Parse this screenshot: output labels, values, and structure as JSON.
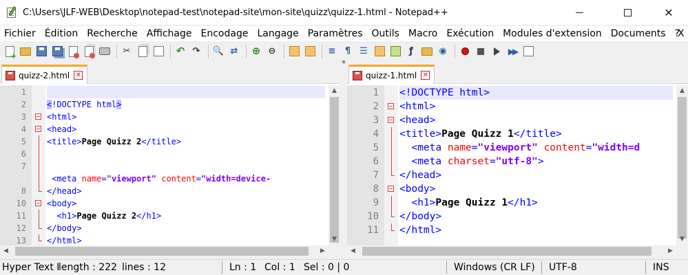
{
  "window": {
    "title": "C:\\Users\\JLF-WEB\\Desktop\\notepad-test\\notepad-site\\mon-site\\quizz\\quizz-1.html - Notepad++",
    "minimize_label": "",
    "maximize_label": "",
    "close_label": "✕"
  },
  "menu": {
    "items": [
      "Fichier",
      "Édition",
      "Recherche",
      "Affichage",
      "Encodage",
      "Langage",
      "Paramètres",
      "Outils",
      "Macro",
      "Exécution",
      "Modules d'extension",
      "Documents",
      "?"
    ],
    "close": "X"
  },
  "toolbar": {
    "icons": [
      "new-file-icon",
      "open-folder-icon",
      "save-icon",
      "save-all-icon",
      "close-icon",
      "close-all-icon",
      "print-icon",
      "cut-icon",
      "copy-icon",
      "paste-icon",
      "undo-icon",
      "redo-icon",
      "find-icon",
      "replace-icon",
      "zoom-in-icon",
      "zoom-out-icon",
      "sync-vertical-icon",
      "sync-horizontal-icon",
      "word-wrap-icon",
      "show-all-chars-icon",
      "indent-guide-icon",
      "lang-define-icon",
      "doc-map-icon",
      "function-list-icon",
      "folder-workspace-icon",
      "monitoring-icon",
      "record-macro-icon",
      "stop-macro-icon",
      "play-macro-icon",
      "run-macro-multiple-icon",
      "save-macro-icon"
    ]
  },
  "left_pane": {
    "tab_label": "quizz-2.html",
    "lines": [
      {
        "n": "1",
        "fold": "",
        "tokens": []
      },
      {
        "n": "2",
        "fold": "",
        "tokens": [
          {
            "c": "t-tag t-hl",
            "t": "<"
          },
          {
            "c": "t-tag",
            "t": "!DOCTYPE html"
          },
          {
            "c": "t-tag t-hl",
            "t": ">"
          }
        ]
      },
      {
        "n": "3",
        "fold": "open",
        "tokens": [
          {
            "c": "t-tag",
            "t": "<html>"
          }
        ]
      },
      {
        "n": "4",
        "fold": "open",
        "tokens": [
          {
            "c": "t-tag",
            "t": "<head>"
          }
        ]
      },
      {
        "n": "5",
        "fold": "line",
        "tokens": [
          {
            "c": "t-tag",
            "t": "<title>"
          },
          {
            "c": "t-txt",
            "t": "Page Quizz 2"
          },
          {
            "c": "t-tag",
            "t": "</title>"
          }
        ]
      },
      {
        "n": "6",
        "fold": "line",
        "tokens": []
      },
      {
        "n": "7",
        "fold": "line",
        "tokens": []
      },
      {
        "n": "",
        "fold": "line",
        "tokens": [
          {
            "c": "t-plain",
            "t": " "
          },
          {
            "c": "t-tag",
            "t": "<meta "
          },
          {
            "c": "t-attr",
            "t": "name"
          },
          {
            "c": "t-tag",
            "t": "="
          },
          {
            "c": "t-val",
            "t": "\"viewport\""
          },
          {
            "c": "t-plain",
            "t": " "
          },
          {
            "c": "t-attr",
            "t": "content"
          },
          {
            "c": "t-tag",
            "t": "="
          },
          {
            "c": "t-val",
            "t": "\"width=device-"
          }
        ]
      },
      {
        "n": "8",
        "fold": "end",
        "tokens": [
          {
            "c": "t-tag",
            "t": "</head>"
          }
        ]
      },
      {
        "n": "10",
        "fold": "open",
        "tokens": [
          {
            "c": "t-tag",
            "t": "<body>"
          }
        ]
      },
      {
        "n": "11",
        "fold": "line",
        "tokens": [
          {
            "c": "t-plain",
            "t": "  "
          },
          {
            "c": "t-tag",
            "t": "<h1>"
          },
          {
            "c": "t-txt",
            "t": "Page Quizz 2"
          },
          {
            "c": "t-tag",
            "t": "</h1>"
          }
        ]
      },
      {
        "n": "12",
        "fold": "end",
        "tokens": [
          {
            "c": "t-tag",
            "t": "</body>"
          }
        ]
      },
      {
        "n": "13",
        "fold": "end",
        "tokens": [
          {
            "c": "t-tag",
            "t": "</html>"
          }
        ]
      }
    ]
  },
  "right_pane": {
    "tab_label": "quizz-1.html",
    "lines": [
      {
        "n": "1",
        "fold": "",
        "tokens": [
          {
            "c": "t-tag",
            "t": "<!DOCTYPE html>"
          }
        ]
      },
      {
        "n": "2",
        "fold": "open",
        "tokens": [
          {
            "c": "t-tag",
            "t": "<html>"
          }
        ]
      },
      {
        "n": "3",
        "fold": "open",
        "tokens": [
          {
            "c": "t-tag",
            "t": "<head>"
          }
        ]
      },
      {
        "n": "4",
        "fold": "line",
        "tokens": [
          {
            "c": "t-tag",
            "t": "<title>"
          },
          {
            "c": "t-txt",
            "t": "Page Quizz 1"
          },
          {
            "c": "t-tag",
            "t": "</title>"
          }
        ]
      },
      {
        "n": "5",
        "fold": "line",
        "tokens": [
          {
            "c": "t-plain",
            "t": "  "
          },
          {
            "c": "t-tag",
            "t": "<meta "
          },
          {
            "c": "t-attr",
            "t": "name"
          },
          {
            "c": "t-tag",
            "t": "="
          },
          {
            "c": "t-val",
            "t": "\"viewport\""
          },
          {
            "c": "t-plain",
            "t": " "
          },
          {
            "c": "t-attr",
            "t": "content"
          },
          {
            "c": "t-tag",
            "t": "="
          },
          {
            "c": "t-val",
            "t": "\"width=d"
          }
        ]
      },
      {
        "n": "6",
        "fold": "line",
        "tokens": [
          {
            "c": "t-plain",
            "t": "  "
          },
          {
            "c": "t-tag",
            "t": "<meta "
          },
          {
            "c": "t-attr",
            "t": "charset"
          },
          {
            "c": "t-tag",
            "t": "="
          },
          {
            "c": "t-val",
            "t": "\"utf-8\""
          },
          {
            "c": "t-tag",
            "t": ">"
          }
        ]
      },
      {
        "n": "7",
        "fold": "end",
        "tokens": [
          {
            "c": "t-tag",
            "t": "</head>"
          }
        ]
      },
      {
        "n": "8",
        "fold": "open",
        "tokens": [
          {
            "c": "t-tag",
            "t": "<body>"
          }
        ]
      },
      {
        "n": "9",
        "fold": "line",
        "tokens": [
          {
            "c": "t-plain",
            "t": "  "
          },
          {
            "c": "t-tag",
            "t": "<h1>"
          },
          {
            "c": "t-txt",
            "t": "Page Quizz 1"
          },
          {
            "c": "t-tag",
            "t": "</h1>"
          }
        ]
      },
      {
        "n": "10",
        "fold": "end",
        "tokens": [
          {
            "c": "t-tag",
            "t": "</body>"
          }
        ]
      },
      {
        "n": "11",
        "fold": "end",
        "tokens": [
          {
            "c": "t-tag",
            "t": "</html>"
          }
        ]
      }
    ]
  },
  "status": {
    "type": "Hyper Text I",
    "length": "length : 222",
    "lines": "lines : 12",
    "ln": "Ln : 1",
    "col": "Col : 1",
    "sel": "Sel : 0 | 0",
    "eol": "Windows (CR LF)",
    "encoding": "UTF-8",
    "mode": "INS"
  }
}
